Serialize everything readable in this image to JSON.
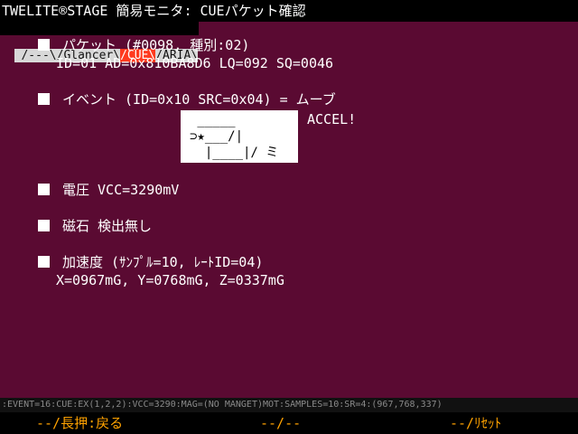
{
  "titlebar": {
    "app": "TWELITE®STAGE",
    "subtitle": " 簡易モニタ: CUEパケット確認"
  },
  "tabs": [
    {
      "label": " /---\\/Glancer\\"
    },
    {
      "label": "/CUE\\"
    },
    {
      "label": "/ARIA\\"
    }
  ],
  "packet": {
    "heading": "パケット (#0098, 種別:02)",
    "detail": "ID=01 AD=0x810BA8D6 LQ=092 SQ=0046"
  },
  "event": {
    "heading": "イベント (ID=0x10 SRC=0x04) = ムーブ",
    "art": " _____\n⊃★___/|\n  |____|/ ミ",
    "accel": "ACCEL!"
  },
  "voltage": {
    "heading": "電圧 VCC=3290mV"
  },
  "magnet": {
    "heading": "磁石 検出無し"
  },
  "accel": {
    "heading": "加速度 (ｻﾝﾌﾟﾙ=10, ﾚｰﾄID=04)",
    "detail": "X=0967mG, Y=0768mG, Z=0337mG"
  },
  "footer": {
    "log": ":EVENT=16:CUE:EX(1,2,2):VCC=3290:MAG=(NO MANGET)MOT:SAMPLES=10:SR=4:(967,768,337)",
    "btn_left": "--/長押:戻る",
    "btn_mid": "--/--",
    "btn_right": "--/ﾘｾｯﾄ"
  }
}
